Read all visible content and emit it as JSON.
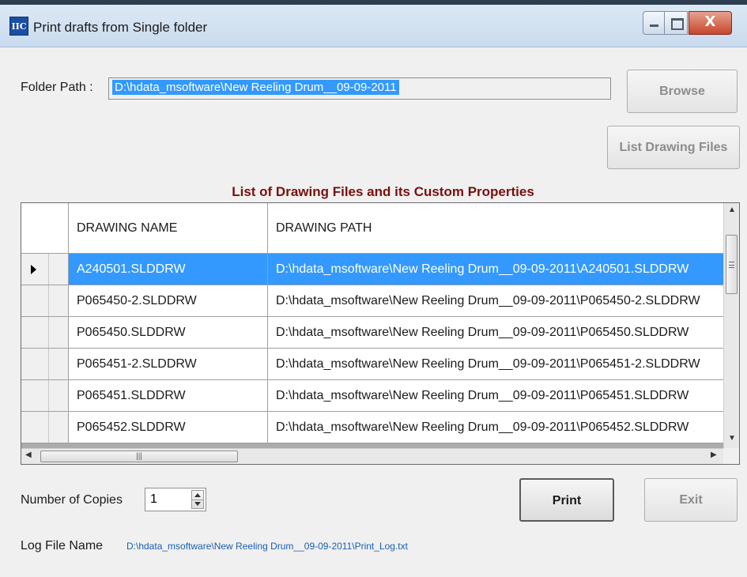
{
  "window": {
    "title": "Print drafts from Single folder",
    "app_icon_text": "IIC",
    "close_glyph": "X"
  },
  "folder": {
    "label": "Folder Path :",
    "value": "D:\\hdata_msoftware\\New Reeling Drum__09-09-2011"
  },
  "buttons": {
    "browse": "Browse",
    "list_drawing_files": "List Drawing Files",
    "print": "Print",
    "exit": "Exit"
  },
  "grid": {
    "caption": "List of Drawing Files and its Custom Properties",
    "columns": [
      "DRAWING NAME",
      "DRAWING PATH"
    ],
    "selected_row": 0,
    "rows": [
      {
        "name": "A240501.SLDDRW",
        "path": "D:\\hdata_msoftware\\New Reeling Drum__09-09-2011\\A240501.SLDDRW"
      },
      {
        "name": "P065450-2.SLDDRW",
        "path": "D:\\hdata_msoftware\\New Reeling Drum__09-09-2011\\P065450-2.SLDDRW"
      },
      {
        "name": "P065450.SLDDRW",
        "path": "D:\\hdata_msoftware\\New Reeling Drum__09-09-2011\\P065450.SLDDRW"
      },
      {
        "name": "P065451-2.SLDDRW",
        "path": "D:\\hdata_msoftware\\New Reeling Drum__09-09-2011\\P065451-2.SLDDRW"
      },
      {
        "name": "P065451.SLDDRW",
        "path": "D:\\hdata_msoftware\\New Reeling Drum__09-09-2011\\P065451.SLDDRW"
      },
      {
        "name": "P065452.SLDDRW",
        "path": "D:\\hdata_msoftware\\New Reeling Drum__09-09-2011\\P065452.SLDDRW"
      }
    ]
  },
  "copies": {
    "label": "Number of Copies",
    "value": "1"
  },
  "log": {
    "label": "Log File Name",
    "value": "D:\\hdata_msoftware\\New Reeling Drum__09-09-2011\\Print_Log.txt"
  },
  "colors": {
    "selection": "#3399ff",
    "caption": "#7a0f0f",
    "log_link": "#1a5fb4"
  }
}
